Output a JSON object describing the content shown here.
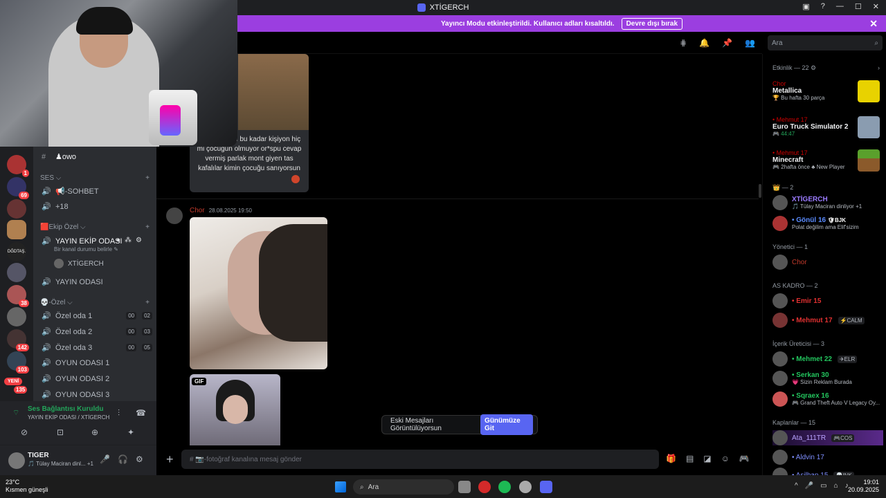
{
  "window": {
    "title": "XTİGERCH"
  },
  "banner": {
    "text": "Yayıncı Modu etkinleştirildi. Kullanıcı adları kısaltıldı.",
    "button": "Devre dışı bırak"
  },
  "channels": {
    "text_channel": "♟owo",
    "cat_ses": "SES ⌵",
    "sohbet": "📢-SOHBET",
    "plus18": "+18",
    "cat_ekip": "🟥Ekip Özel ⌵",
    "yayin_ekip": "YAYIN EKİP ODASI",
    "yayin_ekip_status": "Bir kanal durumu belirle ✎",
    "yayin_ekip_user": "XTİGERCH",
    "yayin_odasi": "YAYIN ODASI",
    "cat_ozel": "💀-Özel ⌵",
    "ozel1": "Özel oda 1",
    "ozel1_a": "00",
    "ozel1_b": "02",
    "ozel2": "Özel oda 2",
    "ozel2_a": "00",
    "ozel2_b": "03",
    "ozel3": "Özel oda 3",
    "ozel3_a": "00",
    "ozel3_b": "05",
    "oyun1": "OYUN ODASI 1",
    "oyun2": "OYUN ODASI 2",
    "oyun3": "OYUN ODASI 3"
  },
  "rail_badges": [
    "1",
    "69",
    "38",
    "142",
    "103",
    "135"
  ],
  "rail_new": "YENİ",
  "rail_server_text": "DĞDTAŞ.",
  "voice": {
    "status": "Ses Bağlantısı Kuruldu",
    "channel": "YAYIN EKİP ODASI / XTİGERCH"
  },
  "user": {
    "name": "TIGER",
    "status": "🎵 Tülay Maciran dinl...  +1"
  },
  "chat": {
    "card_text": "armuşlar sen bu kadar kişiyon hiç mi çocuğun olmuyor or*spu cevap vermiş parlak mont giyen tas kafalılar kimin çocuğu sanıyorsun",
    "author": "Chor",
    "timestamp": "28.08.2025 19:50",
    "gif_label": "GIF",
    "input_placeholder": "# 📷-fotoğraf kanalına mesaj gönder",
    "old_messages": "Eski Mesajları Görüntülüyorsun",
    "go_button": "Günümüze Git"
  },
  "search": {
    "placeholder": "Ara"
  },
  "activity": {
    "header": "Etkinlik — 22 ⚙",
    "items": [
      {
        "user": "Chor",
        "game": "Metallica",
        "detail": "🏆 Bu hafta 30 parça"
      },
      {
        "user": "• Mehmut 17",
        "game": "Euro Truck Simulator 2",
        "detail": "🎮 44:47"
      },
      {
        "user": "• Mehmut 17",
        "game": "Minecraft",
        "detail": "🎮 2hafta önce  ♣ New Player"
      }
    ]
  },
  "members": {
    "crown_group": "👑 — 2",
    "xtigerch": "XTİGERCH",
    "xtigerch_sub": "🎵 Tülay Maciran dinliyor +1",
    "gonul": "• Gönül 16",
    "gonul_tag": "🛡BJK",
    "gonul_sub": "Polat değilim ama Elif'sizim",
    "yonetici": "Yönetici — 1",
    "chor": "Chor",
    "as_kadro": "AS KADRO — 2",
    "emir": "• Emir 15",
    "mehmut": "• Mehmut 17",
    "mehmut_tag": "⚡CALM",
    "icerik": "İçerik Üreticisi — 3",
    "mehmet": "• Mehmet 22",
    "mehmet_tag": "✈ELR",
    "serkan": "• Serkan 30",
    "serkan_sub": "💗 Sizin Reklam Burada",
    "sqraex": "• Sqraex 16",
    "sqraex_sub": "🎮 Grand Theft Auto V Legacy Oy...",
    "kaplanlar": "Kaplanlar — 15",
    "ata": "Ata_111TR",
    "ata_tag": "🎮COS",
    "aldvin": "• Aldvin 17",
    "asilhan": "• Asilhan 15",
    "asilhan_tag": "💀INK"
  },
  "taskbar": {
    "temp": "23°C",
    "weather": "Kısmen güneşli",
    "search": "Ara",
    "time": "19:01",
    "date": "20.09.2025"
  },
  "colors": {
    "accent": "#5865f2",
    "banner": "#9b3ee0",
    "danger": "#f23f43",
    "online": "#23a55a"
  }
}
